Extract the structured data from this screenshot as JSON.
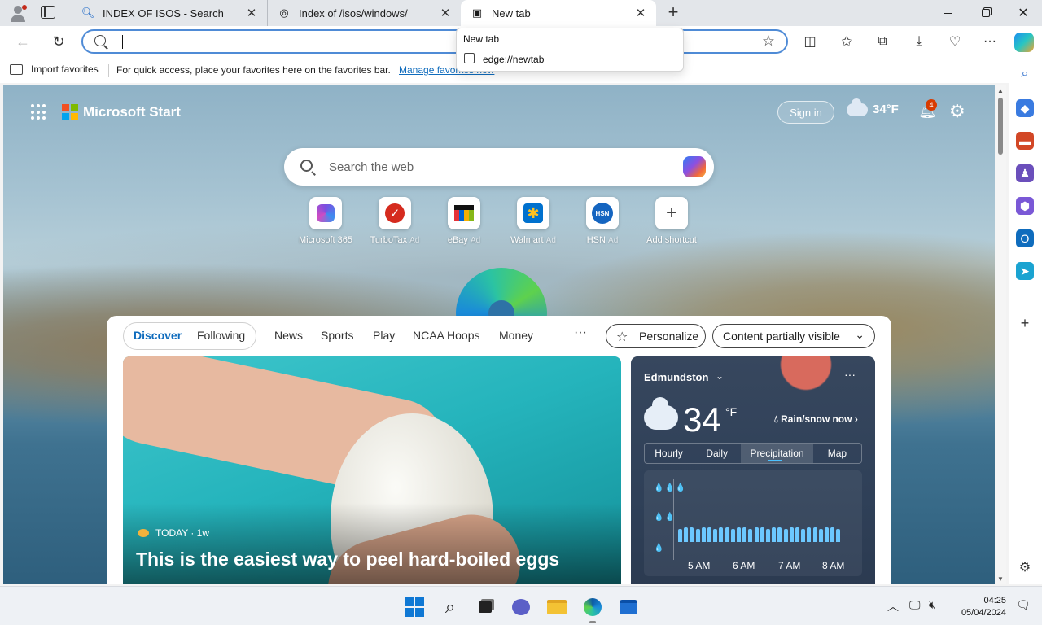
{
  "browser": {
    "tabs": [
      {
        "title": "INDEX OF ISOS - Search",
        "icon": "search-icon"
      },
      {
        "title": "Index of /isos/windows/",
        "icon": "page-icon"
      },
      {
        "title": "New tab",
        "icon": "newtab-icon",
        "active": true
      }
    ],
    "tooltip": {
      "title": "New tab",
      "url": "edge://newtab"
    }
  },
  "favorites_bar": {
    "import_label": "Import favorites",
    "message": "For quick access, place your favorites here on the favorites bar.",
    "manage_link": "Manage favorites now"
  },
  "start": {
    "brand": "Microsoft Start",
    "sign_in": "Sign in",
    "header_temp": "34°F",
    "notification_count": "4",
    "search_placeholder": "Search the web",
    "shortcuts": [
      {
        "label": "Microsoft 365",
        "ad": ""
      },
      {
        "label": "TurboTax",
        "ad": "Ad"
      },
      {
        "label": "eBay",
        "ad": "Ad"
      },
      {
        "label": "Walmart",
        "ad": "Ad"
      },
      {
        "label": "HSN",
        "ad": "Ad"
      },
      {
        "label": "Add shortcut",
        "ad": ""
      }
    ],
    "feed_tabs": [
      "Discover",
      "Following"
    ],
    "nav_items": [
      "News",
      "Sports",
      "Play",
      "NCAA Hoops",
      "Money"
    ],
    "more": "···",
    "personalize": "Personalize",
    "visibility": "Content partially visible",
    "hero": {
      "source": "TODAY · 1w",
      "title": "This is the easiest way to peel hard-boiled eggs"
    },
    "weather": {
      "location": "Edmundston",
      "temp": "34",
      "unit": "°F",
      "condition": "Rain/snow now",
      "tabs": [
        "Hourly",
        "Daily",
        "Precipitation",
        "Map"
      ],
      "hours": [
        "5 AM",
        "6 AM",
        "7 AM",
        "8 AM"
      ],
      "precip_levels": [
        "💧💧💧",
        "💧💧",
        "💧"
      ]
    }
  },
  "taskbar": {
    "time": "04:25",
    "date": "05/04/2024"
  },
  "colors": {
    "accent": "#0f6cbd",
    "address_border": "#4f8bd6",
    "weather_bg": "#2f4058"
  }
}
